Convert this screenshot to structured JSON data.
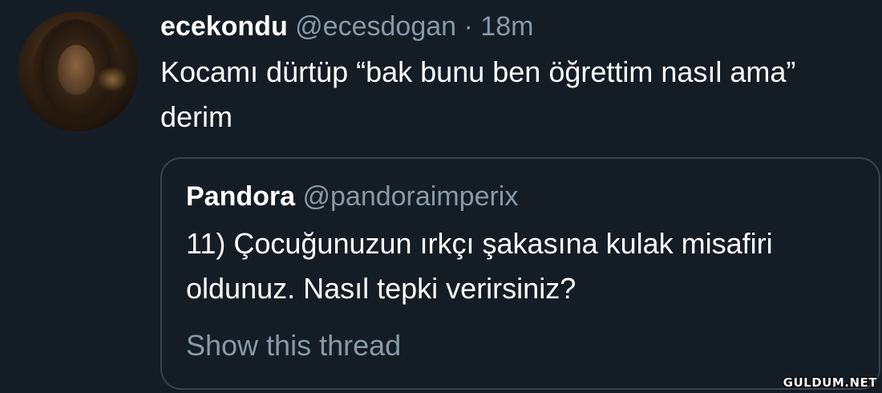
{
  "tweet": {
    "display_name": "ecekondu",
    "handle": "@ecesdogan",
    "separator": "·",
    "time": "18m",
    "text": "Kocamı dürtüp “bak bunu ben öğrettim nasıl ama” derim"
  },
  "quoted_tweet": {
    "display_name": "Pandora",
    "handle": "@pandoraimperix",
    "text": "11) Çocuğunuzun ırkçı şakasına kulak misafiri oldunuz. Nasıl tepki verirsiniz?",
    "show_thread_label": "Show this thread"
  },
  "watermark": "GULDUM.NET",
  "colors": {
    "background": "#141d26",
    "primary_text": "#ffffff",
    "secondary_text": "#8899a6",
    "border": "#38444d"
  }
}
